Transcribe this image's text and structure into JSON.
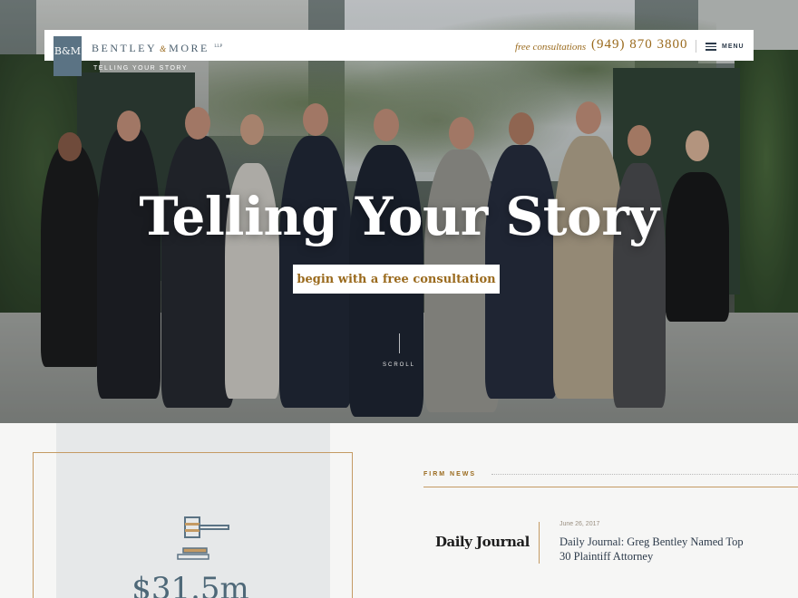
{
  "header": {
    "logo_mark": "B&M",
    "brand_name": "BENTLEY",
    "brand_amp": "&",
    "brand_name2": "MORE",
    "brand_suffix": "LLP",
    "tagline": "TELLING YOUR STORY",
    "consult_label": "free consultations",
    "phone": "(949) 870 3800",
    "menu_label": "MENU",
    "menu_icon": "hamburger-icon"
  },
  "hero": {
    "title": "Telling Your Story",
    "cta_label": "begin with a free consultation",
    "scroll_label": "SCROLL"
  },
  "stats": {
    "icon": "gavel-icon",
    "value": "$31.5m"
  },
  "news": {
    "section_label": "FIRM NEWS",
    "items": [
      {
        "source": "Daily Journal",
        "date": "June 26, 2017",
        "title": "Daily Journal: Greg Bentley Named Top 30 Plaintiff Attorney"
      }
    ]
  },
  "colors": {
    "accent_gold": "#9a6a1d",
    "brand_slate": "#5b7384",
    "rule_gold": "#c49a63"
  }
}
